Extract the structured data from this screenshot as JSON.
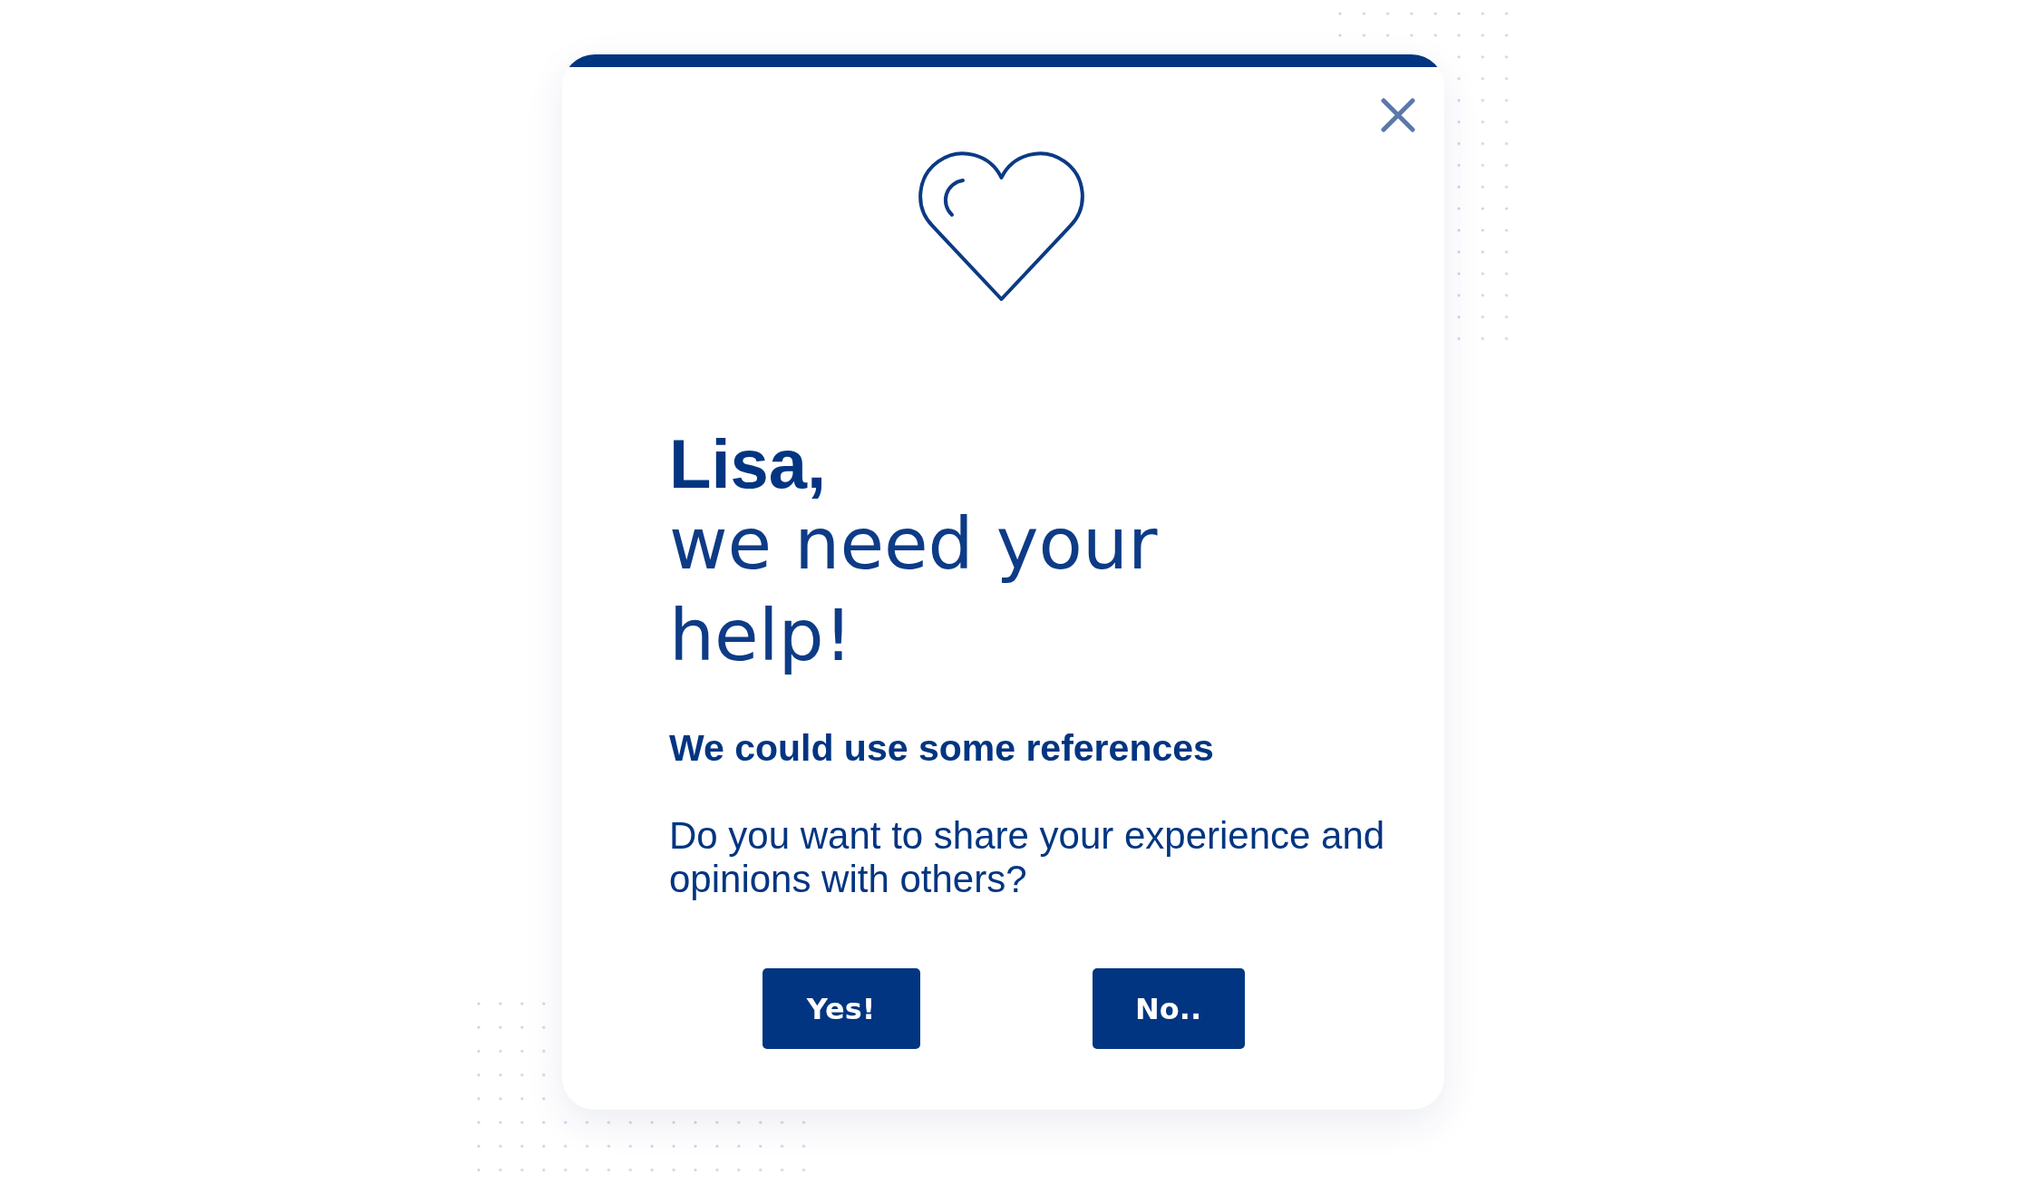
{
  "dialog": {
    "greeting": "Lisa,",
    "headline": "we need your help!",
    "subtitle": "We could use some references",
    "message": "Do you want to share your experience and opinions with others?",
    "buttons": [
      {
        "label": "Yes!"
      },
      {
        "label": "No.."
      }
    ]
  }
}
